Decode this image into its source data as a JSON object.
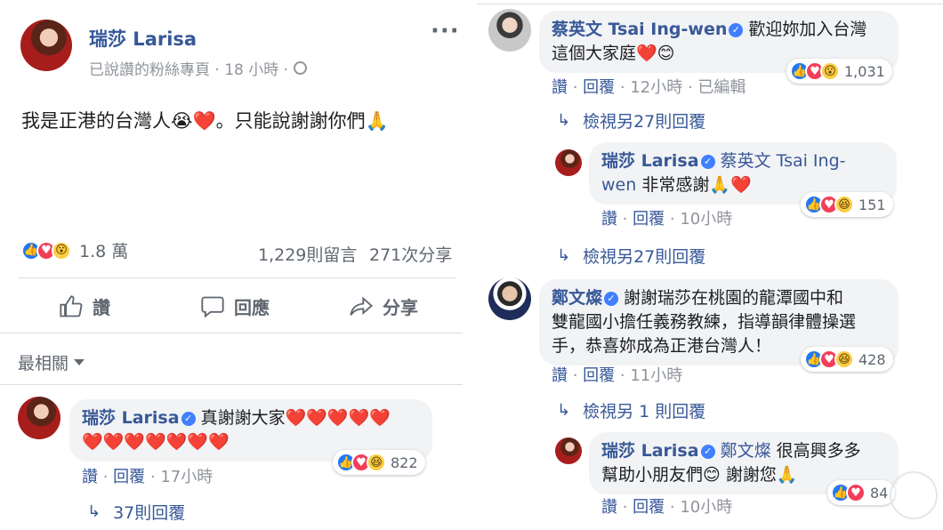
{
  "post": {
    "author": "瑞莎 Larisa",
    "meta": "已說讚的粉絲專頁 · 18 小時 ·",
    "text": "我是正港的台灣人😭❤️。只能說謝謝你們🙏",
    "reactions_count": "1.8 萬",
    "comments_count": "1,229則留言",
    "shares_count": "271次分享",
    "actions": {
      "like": "讚",
      "comment": "回應",
      "share": "分享"
    }
  },
  "sort": {
    "label": "最相關"
  },
  "comments": [
    {
      "author": "瑞莎 Larisa",
      "text_line1": "真謝謝大家❤️❤️❤️❤️❤️",
      "text_line2": "❤️❤️❤️❤️❤️❤️❤️",
      "reaction_count": "822",
      "like": "讚",
      "reply": "回覆",
      "time": "17小時",
      "view_replies": "37則回覆"
    },
    {
      "author": "蔡英文 Tsai Ing-wen",
      "text_line1": "歡迎妳加入台灣",
      "text_line2": "這個大家庭❤️😊",
      "reaction_count": "1,031",
      "like": "讚",
      "reply": "回覆",
      "time": "12小時",
      "edited": "已編輯",
      "view_replies": "檢視另27則回覆"
    },
    {
      "author": "瑞莎 Larisa",
      "mention": "蔡英文 Tsai Ing-",
      "mention2": "wen",
      "text": "非常感謝🙏❤️",
      "reaction_count": "151",
      "like": "讚",
      "reply": "回覆",
      "time": "10小時",
      "view_replies": "檢視另27則回覆"
    },
    {
      "author": "鄭文燦",
      "text_line1": "謝謝瑞莎在桃園的龍潭國中和",
      "text_line2": "雙龍國小擔任義務教練，指導韻律體操選",
      "text_line3": "手，恭喜妳成為正港台灣人！",
      "reaction_count": "428",
      "like": "讚",
      "reply": "回覆",
      "time": "11小時",
      "view_replies": "檢視另 1 則回覆"
    },
    {
      "author": "瑞莎 Larisa",
      "mention": "鄭文燦",
      "text_line1": "很高興多多",
      "text_line2": "幫助小朋友們😊 謝謝您🙏",
      "reaction_count": "84",
      "like": "讚",
      "reply": "回覆",
      "time": "10小時"
    }
  ],
  "icons": {
    "like": "thumbs-up-icon",
    "comment": "speech-bubble-icon",
    "share": "share-arrow-icon",
    "more": "more-icon",
    "globe": "globe-icon"
  },
  "colors": {
    "link": "#385898",
    "name": "#365899",
    "muted": "#90949c",
    "bubble": "#f2f3f5",
    "like": "#2078f4",
    "love": "#f33e58",
    "wow": "#fbcd44"
  }
}
